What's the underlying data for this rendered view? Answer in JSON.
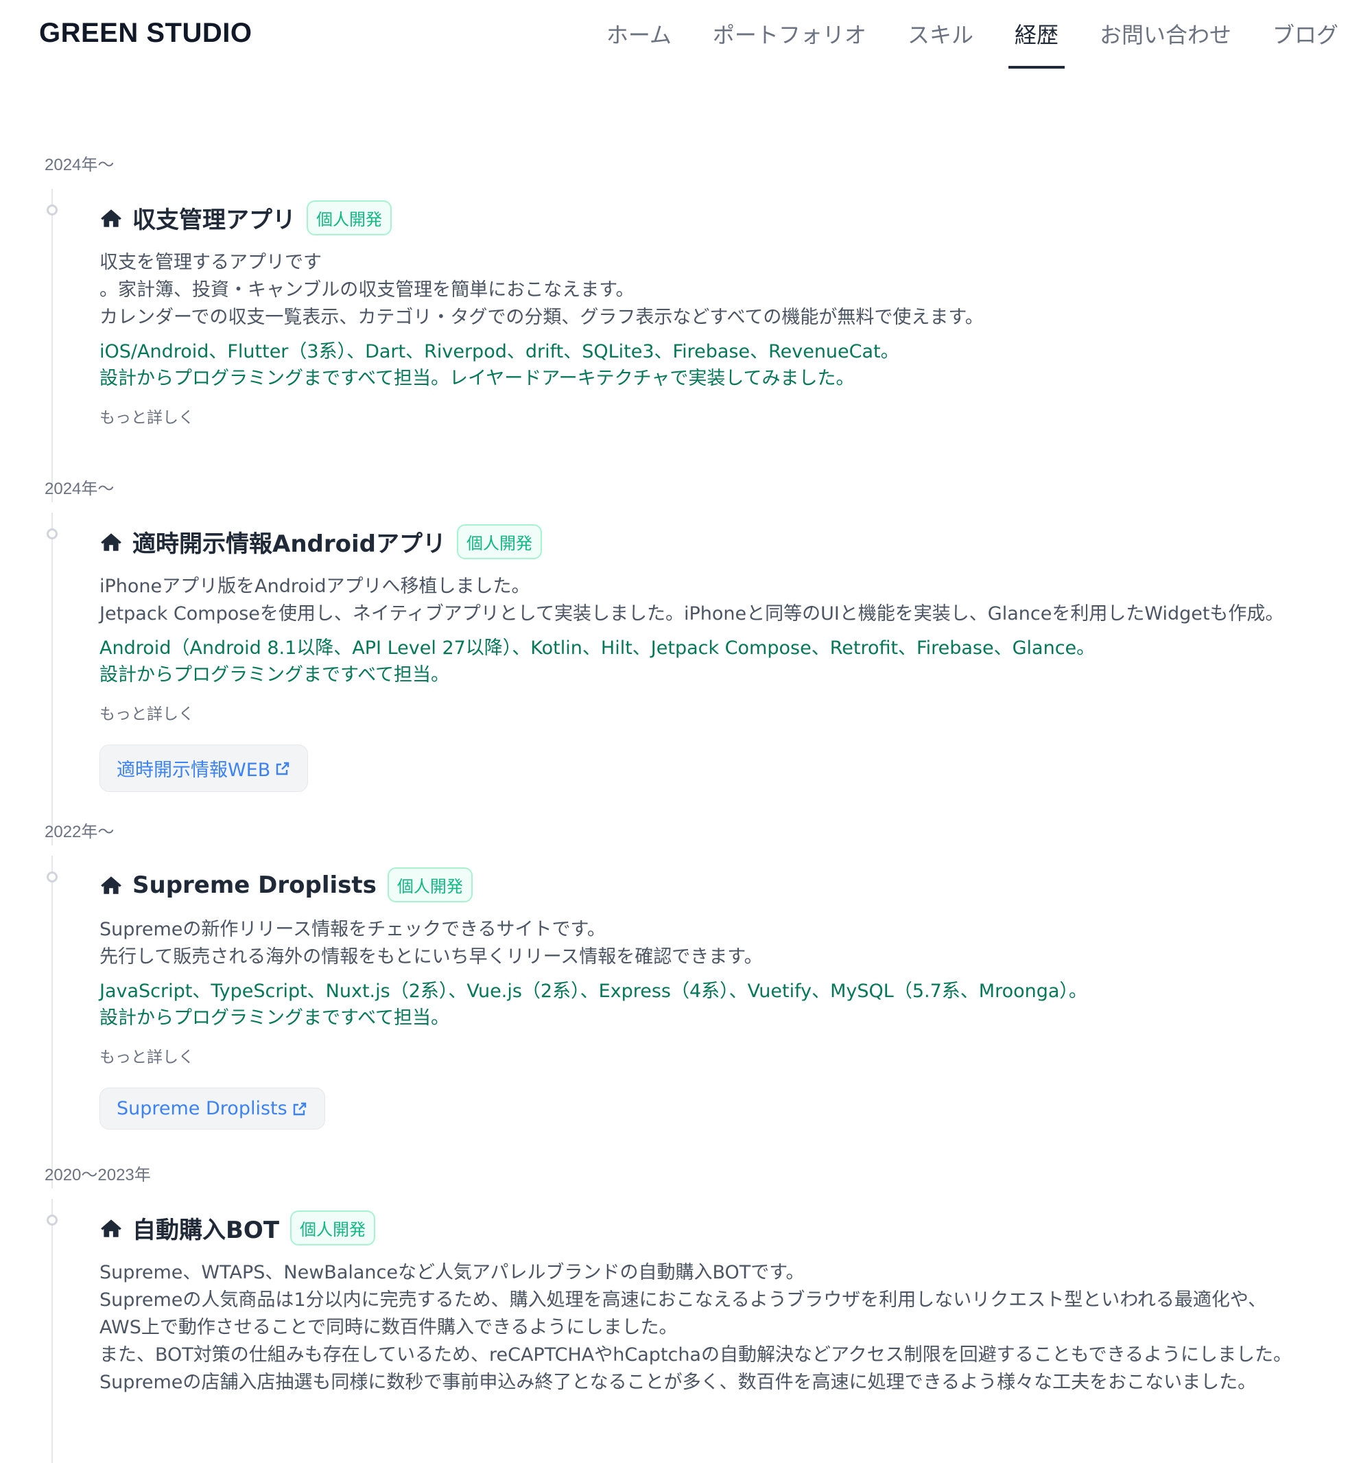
{
  "header": {
    "brand": "GREEN STUDIO",
    "nav": [
      {
        "label": "ホーム",
        "active": false
      },
      {
        "label": "ポートフォリオ",
        "active": false
      },
      {
        "label": "スキル",
        "active": false
      },
      {
        "label": "経歴",
        "active": true
      },
      {
        "label": "お問い合わせ",
        "active": false
      },
      {
        "label": "ブログ",
        "active": false
      }
    ]
  },
  "entries": [
    {
      "period": "2024年〜",
      "title": "収支管理アプリ",
      "badge": "個人開発",
      "description": "収支を管理するアプリです\n。家計簿、投資・キャンブルの収支管理を簡単におこなえます。\nカレンダーでの収支一覧表示、カテゴリ・タグでの分類、グラフ表示などすべての機能が無料で使えます。",
      "tech": "iOS/Android、Flutter（3系）、Dart、Riverpod、drift、SQLite3、Firebase、RevenueCat。\n設計からプログラミングまですべて担当。レイヤードアーキテクチャで実装してみました。",
      "more": "もっと詳しく",
      "link": ""
    },
    {
      "period": "2024年〜",
      "title": "適時開示情報Androidアプリ",
      "badge": "個人開発",
      "description": "iPhoneアプリ版をAndroidアプリへ移植しました。\nJetpack Composeを使用し、ネイティブアプリとして実装しました。iPhoneと同等のUIと機能を実装し、Glanceを利用したWidgetも作成。",
      "tech": "Android（Android 8.1以降、API Level 27以降）、Kotlin、Hilt、Jetpack Compose、Retrofit、Firebase、Glance。\n設計からプログラミングまですべて担当。",
      "more": "もっと詳しく",
      "link": "適時開示情報WEB"
    },
    {
      "period": "2022年〜",
      "title": "Supreme Droplists",
      "badge": "個人開発",
      "description": "Supremeの新作リリース情報をチェックできるサイトです。\n先行して販売される海外の情報をもとにいち早くリリース情報を確認できます。",
      "tech": "JavaScript、TypeScript、Nuxt.js（2系）、Vue.js（2系）、Express（4系）、Vuetify、MySQL（5.7系、Mroonga）。\n設計からプログラミングまですべて担当。",
      "more": "もっと詳しく",
      "link": "Supreme Droplists"
    },
    {
      "period": "2020〜2023年",
      "title": "自動購入BOT",
      "badge": "個人開発",
      "description": "Supreme、WTAPS、NewBalanceなど人気アパレルブランドの自動購入BOTです。\nSupremeの人気商品は1分以内に完売するため、購入処理を高速におこなえるようブラウザを利用しないリクエスト型といわれる最適化や、\nAWS上で動作させることで同時に数百件購入できるようにしました。\nまた、BOT対策の仕組みも存在しているため、reCAPTCHAやhCaptchaの自動解決などアクセス制限を回避することもできるようにしました。\nSupremeの店舗入店抽選も同様に数秒で事前申込み終了となることが多く、数百件を高速に処理できるよう様々な工夫をおこないました。",
      "tech": "",
      "more": "",
      "link": ""
    }
  ]
}
